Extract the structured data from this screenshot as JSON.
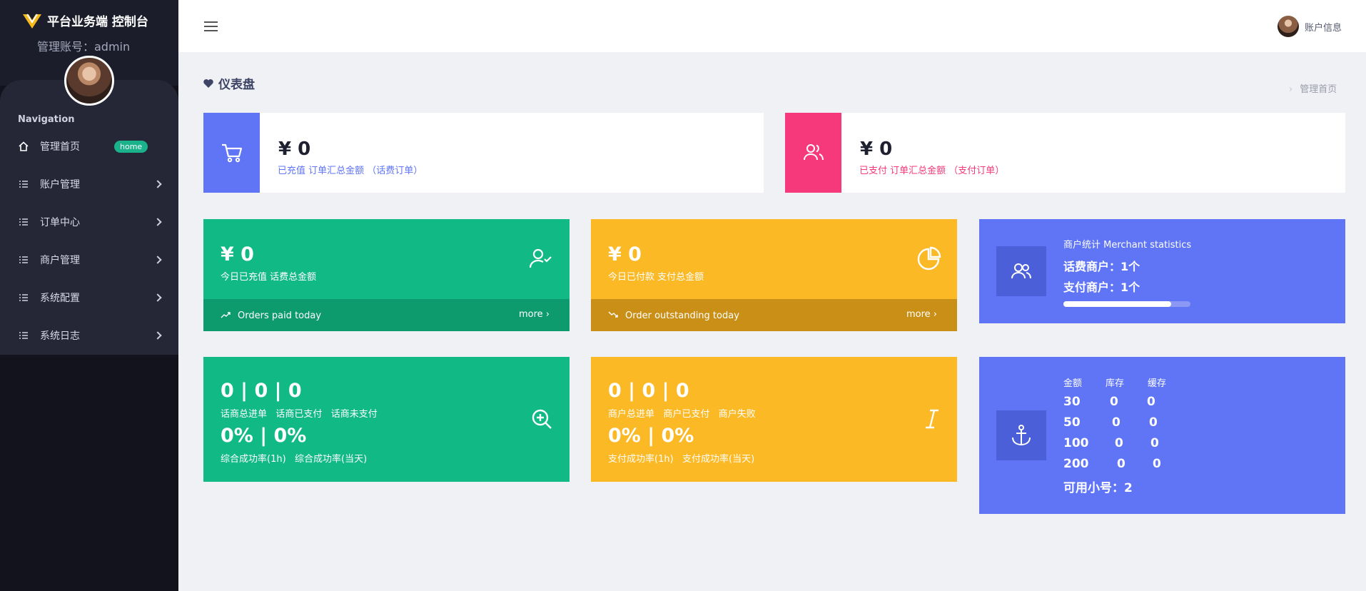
{
  "sidebar": {
    "brand": "平台业务端 控制台",
    "admin_label": "管理账号：admin",
    "nav_title": "Navigation",
    "items": [
      {
        "label": "管理首页",
        "badge": "home"
      },
      {
        "label": "账户管理"
      },
      {
        "label": "订单中心"
      },
      {
        "label": "商户管理"
      },
      {
        "label": "系统配置"
      },
      {
        "label": "系统日志"
      }
    ]
  },
  "header": {
    "user_label": "账户信息"
  },
  "page": {
    "title": "仪表盘",
    "breadcrumb": "管理首页"
  },
  "summary": {
    "recharge": {
      "value": "¥ 0",
      "label": "已充值 订单汇总金额 （话费订单）",
      "color": "#5f75f5"
    },
    "paid": {
      "value": "¥ 0",
      "label": "已支付 订单汇总金额 （支付订单）",
      "color": "#f5397a"
    }
  },
  "today_recharge": {
    "value": "¥ 0",
    "label": "今日已充值 话费总金额",
    "footer": "Orders paid today",
    "more": "more",
    "color": "#11b985"
  },
  "today_paid": {
    "value": "¥ 0",
    "label": "今日已付款 支付总金额",
    "footer": "Order outstanding today",
    "more": "more",
    "color": "#fbb926"
  },
  "merchant": {
    "title": "商户统计 Merchant statistics",
    "line1": "话费商户：1个",
    "line2": "支付商户：1个",
    "progress": 0.85,
    "color": "#5f75f5"
  },
  "green_stats": {
    "counts": "0 | 0 | 0",
    "counts_label": "话商总进单   话商已支付   话商未支付",
    "rates": "0% | 0%",
    "rates_label": "综合成功率(1h)   综合成功率(当天)"
  },
  "yellow_stats": {
    "counts": "0 | 0 | 0",
    "counts_label": "商户总进单   商户已支付   商户失败",
    "rates": "0% | 0%",
    "rates_label": "支付成功率(1h)   支付成功率(当天)"
  },
  "stock": {
    "headers": [
      "金额",
      "库存",
      "缓存"
    ],
    "rows": [
      [
        "30",
        "0",
        "0"
      ],
      [
        "50",
        "0",
        "0"
      ],
      [
        "100",
        "0",
        "0"
      ],
      [
        "200",
        "0",
        "0"
      ]
    ],
    "available": "可用小号：2"
  }
}
